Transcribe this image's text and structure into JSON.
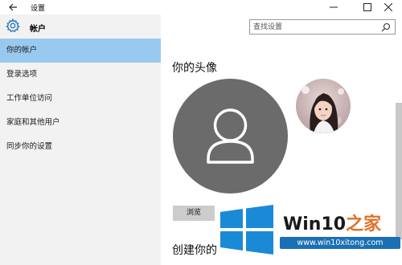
{
  "window": {
    "title": "设置"
  },
  "app": {
    "name": "帐户",
    "icon": "gear-icon"
  },
  "search": {
    "placeholder": "查找设置"
  },
  "sidebar": {
    "items": [
      {
        "label": "你的帐户",
        "active": true
      },
      {
        "label": "登录选项",
        "active": false
      },
      {
        "label": "工作单位访问",
        "active": false
      },
      {
        "label": "家庭和其他用户",
        "active": false
      },
      {
        "label": "同步你的设置",
        "active": false
      }
    ]
  },
  "main": {
    "heading": "你的头像",
    "browse_label": "浏览",
    "sub_heading": "创建你的"
  },
  "watermark": {
    "brand_prefix": "Win10",
    "brand_suffix": "之家",
    "url": "www.win10xitong.com"
  },
  "colors": {
    "sidebar_bg": "#f2f2f2",
    "active_item": "#99c9ef",
    "avatar_bg": "#6b6b6b",
    "logo_blue": "#1b8ad6",
    "watermark_accent": "#e0702a"
  }
}
